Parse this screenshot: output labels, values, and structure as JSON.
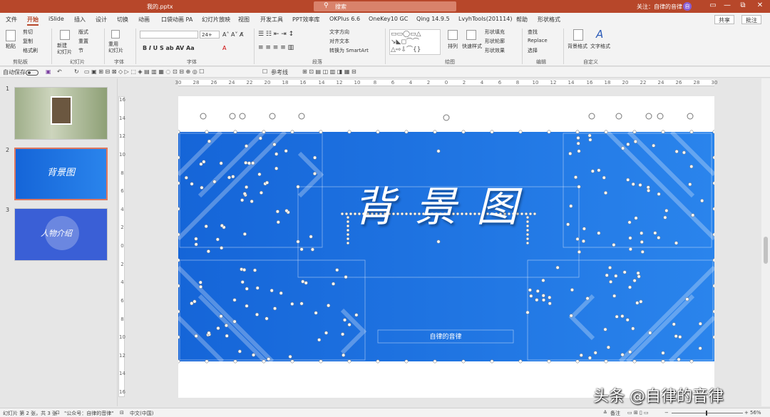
{
  "titlebar": {
    "file_name": "我的.pptx",
    "search_placeholder": "搜索",
    "follow_label": "关注：自律的音律",
    "avatar": "自",
    "min": "—",
    "restore": "□",
    "close": "✕",
    "restore2": "⧉"
  },
  "tabs": [
    "文件",
    "开始",
    "iSlide",
    "插入",
    "设计",
    "切换",
    "动画",
    "口袋动画 PA",
    "幻灯片放映",
    "视图",
    "开发工具",
    "PPT效率库",
    "OKPlus 6.6",
    "OneKey10 GC",
    "Qing 14.9.5",
    "LvyhTools(201114)",
    "帮助",
    "形状格式"
  ],
  "active_tab": "开始",
  "share": {
    "share_label": "共享",
    "comment_label": "批注"
  },
  "ribbon": {
    "clipboard": {
      "paste": "粘贴",
      "cut": "剪切",
      "copy": "复制",
      "format_painter": "格式刷",
      "group": "剪贴板"
    },
    "slides": {
      "new_slide": "新建\n幻灯片",
      "layout": "版式",
      "reset": "重置",
      "section": "节",
      "group": "幻灯片"
    },
    "font_group": {
      "reuse": "重用\n幻灯片",
      "label": "字体"
    },
    "font": {
      "name": "",
      "size": "24+",
      "group": "字体"
    },
    "paragraph": {
      "text_direction": "文字方向",
      "align_text": "对齐文本",
      "smartart": "转换为 SmartArt",
      "group": "段落"
    },
    "drawing": {
      "arrange": "排列",
      "quick_styles": "快速样式",
      "fill": "形状填充",
      "outline": "形状轮廓",
      "effects": "形状效果",
      "group": "绘图"
    },
    "editing": {
      "find": "查找",
      "replace": "Replace",
      "select": "选择",
      "group": "编辑"
    },
    "custom": {
      "bg_format": "背景格式",
      "text_format": "文字格式",
      "group": "自定义"
    }
  },
  "qat": {
    "autosave": "自动保存",
    "autosave_state": "关",
    "ref_line": "参考线"
  },
  "slides": [
    {
      "num": "1"
    },
    {
      "num": "2"
    },
    {
      "num": "3"
    }
  ],
  "thumb3_text": "人物介绍",
  "thumb2_text": "背景图",
  "hruler": [
    "30",
    "28",
    "26",
    "24",
    "22",
    "20",
    "18",
    "16",
    "14",
    "12",
    "10",
    "8",
    "6",
    "4",
    "2",
    "0",
    "2",
    "4",
    "6",
    "8",
    "10",
    "12",
    "14",
    "16",
    "18",
    "20",
    "22",
    "24",
    "26",
    "28",
    "30"
  ],
  "vruler": [
    "16",
    "14",
    "12",
    "10",
    "8",
    "6",
    "4",
    "2",
    "0",
    "2",
    "4",
    "6",
    "8",
    "10",
    "12",
    "14",
    "16"
  ],
  "canvas": {
    "title": "背景图",
    "subtitle": "自律的音律"
  },
  "status": {
    "slide_info": "幻灯片 第 2 张，共 3 张",
    "account": "\"公众号：自律的音律\"",
    "lang": "中文(中国)",
    "notes": "备注",
    "zoom": "56%"
  },
  "watermark": "头条 @自律的音律",
  "colors": {
    "accent": "#b7472a",
    "slide_blue": "#1e73e4"
  }
}
